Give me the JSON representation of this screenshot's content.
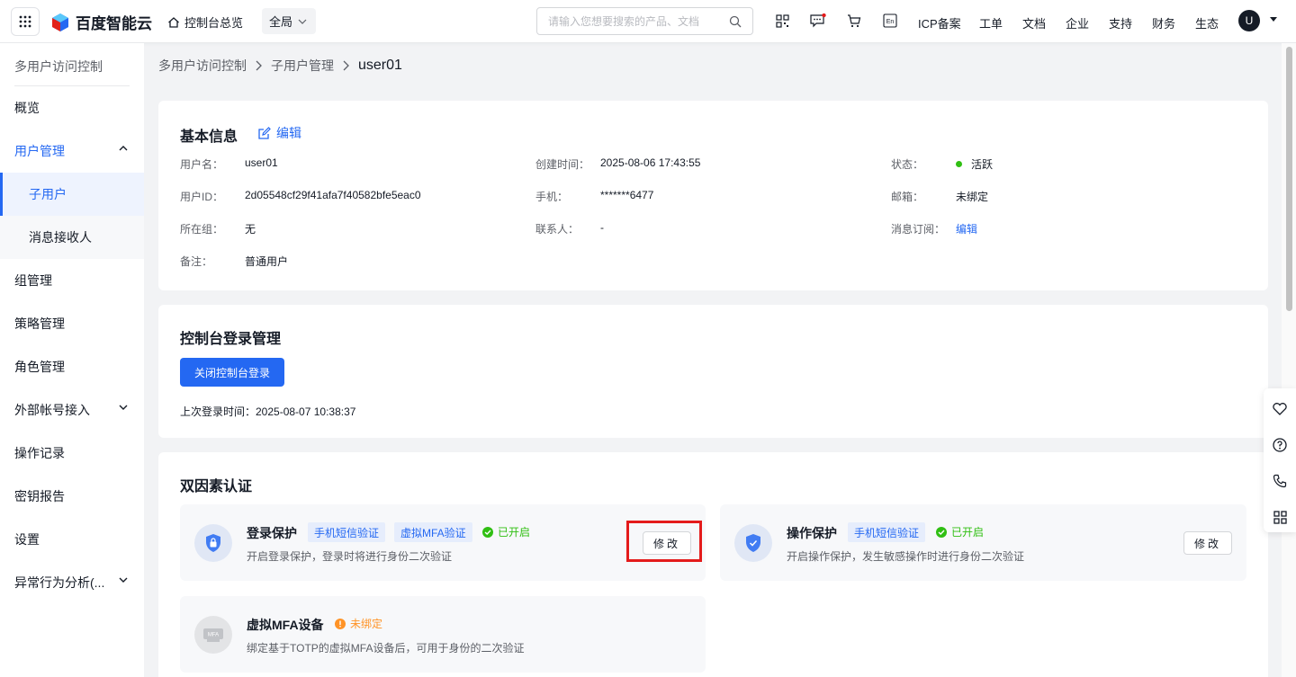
{
  "topbar": {
    "brand": "百度智能云",
    "home_label": "控制台总览",
    "region": "全局",
    "search_placeholder": "请输入您想要搜索的产品、文档",
    "links": [
      "ICP备案",
      "工单",
      "文档",
      "企业",
      "支持",
      "财务",
      "生态"
    ],
    "avatar_letter": "U",
    "lang_icon_text": "En"
  },
  "sidebar": {
    "title": "多用户访问控制",
    "items": [
      {
        "label": "概览"
      },
      {
        "label": "用户管理"
      },
      {
        "label": "子用户"
      },
      {
        "label": "消息接收人"
      },
      {
        "label": "组管理"
      },
      {
        "label": "策略管理"
      },
      {
        "label": "角色管理"
      },
      {
        "label": "外部帐号接入"
      },
      {
        "label": "操作记录"
      },
      {
        "label": "密钥报告"
      },
      {
        "label": "设置"
      },
      {
        "label": "异常行为分析(..."
      }
    ]
  },
  "breadcrumb": [
    "多用户访问控制",
    "子用户管理",
    "user01"
  ],
  "basic_info": {
    "title": "基本信息",
    "edit_label": "编辑",
    "fields": {
      "username": {
        "label": "用户名：",
        "value": "user01"
      },
      "user_id": {
        "label": "用户ID：",
        "value": "2d05548cf29f41afa7f40582bfe5eac0"
      },
      "group": {
        "label": "所在组：",
        "value": "无"
      },
      "remark": {
        "label": "备注：",
        "value": "普通用户"
      },
      "created": {
        "label": "创建时间：",
        "value": "2025-08-06 17:43:55"
      },
      "phone": {
        "label": "手机：",
        "value": "*******6477"
      },
      "contact": {
        "label": "联系人：",
        "value": "-"
      },
      "status": {
        "label": "状态：",
        "value": "活跃"
      },
      "email": {
        "label": "邮箱：",
        "value": "未绑定"
      },
      "subscription": {
        "label": "消息订阅：",
        "value": "编辑"
      }
    }
  },
  "console_login": {
    "title": "控制台登录管理",
    "button_label": "关闭控制台登录",
    "last_login": "上次登录时间：2025-08-07 10:38:37"
  },
  "two_factor": {
    "title": "双因素认证",
    "login_protect": {
      "name": "登录保护",
      "tags": [
        "手机短信验证",
        "虚拟MFA验证"
      ],
      "state": "已开启",
      "desc": "开启登录保护，登录时将进行身份二次验证",
      "button": "修改"
    },
    "op_protect": {
      "name": "操作保护",
      "tags": [
        "手机短信验证"
      ],
      "state": "已开启",
      "desc": "开启操作保护，发生敏感操作时进行身份二次验证",
      "button": "修改"
    },
    "virtual_mfa": {
      "name": "虚拟MFA设备",
      "state": "未绑定",
      "desc": "绑定基于TOTP的虚拟MFA设备后，可用于身份的二次验证",
      "icon_text": "MFA"
    }
  },
  "colors": {
    "primary": "#2468f2",
    "success": "#30bf13",
    "warning": "#ff9326",
    "highlight": "#e41b1b"
  }
}
